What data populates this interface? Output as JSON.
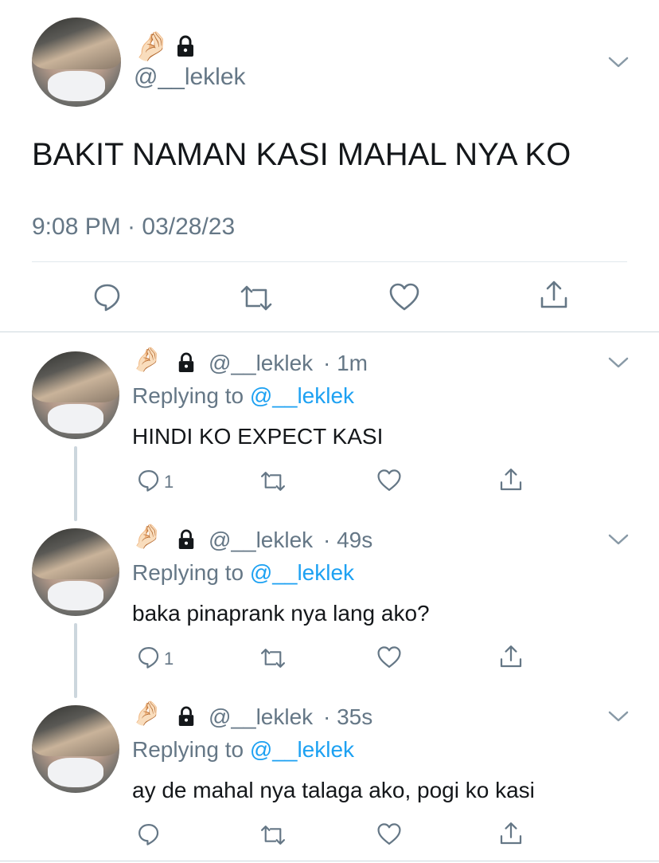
{
  "main_tweet": {
    "emoji": "🤌🏻",
    "handle": "@__leklek",
    "text": "BAKIT NAMAN KASI MAHAL NYA KO",
    "timestamp": "9:08 PM · 03/28/23"
  },
  "replies": [
    {
      "emoji": "🤌🏻",
      "handle": "@__leklek",
      "time": "· 1m",
      "replying_prefix": "Replying to",
      "replying_to": "@__leklek",
      "text": "HINDI KO EXPECT KASI",
      "reply_count": "1"
    },
    {
      "emoji": "🤌🏻",
      "handle": "@__leklek",
      "time": "· 49s",
      "replying_prefix": "Replying to",
      "replying_to": "@__leklek",
      "text": "baka pinaprank nya lang ako?",
      "reply_count": "1"
    },
    {
      "emoji": "🤌🏻",
      "handle": "@__leklek",
      "time": "· 35s",
      "replying_prefix": "Replying to",
      "replying_to": "@__leklek",
      "text": "ay de mahal nya talaga ako, pogi ko kasi",
      "reply_count": ""
    }
  ],
  "icons": {
    "reply": "reply-icon",
    "retweet": "retweet-icon",
    "like": "heart-icon",
    "share": "share-icon",
    "lock": "lock-icon",
    "more": "chevron-down-icon"
  },
  "colors": {
    "link": "#1da1f2",
    "secondary_text": "#657786",
    "divider": "#e1e8ed"
  }
}
